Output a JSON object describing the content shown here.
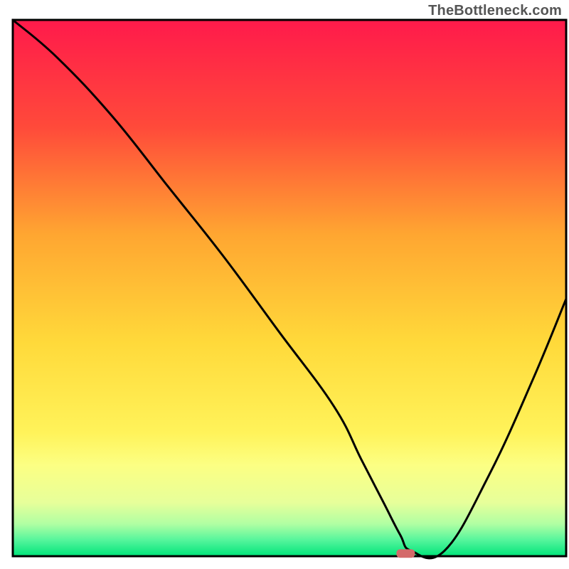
{
  "watermark": "TheBottleneck.com",
  "chart_data": {
    "type": "line",
    "title": "",
    "xlabel": "",
    "ylabel": "",
    "xlim": [
      0,
      100
    ],
    "ylim": [
      0,
      100
    ],
    "background_gradient": {
      "stops": [
        {
          "offset": 0,
          "color": "#ff1a4b"
        },
        {
          "offset": 20,
          "color": "#ff4a3a"
        },
        {
          "offset": 40,
          "color": "#ffa631"
        },
        {
          "offset": 60,
          "color": "#ffd93a"
        },
        {
          "offset": 77,
          "color": "#fff35a"
        },
        {
          "offset": 83,
          "color": "#fcff83"
        },
        {
          "offset": 90,
          "color": "#e7ff9a"
        },
        {
          "offset": 94,
          "color": "#b0ffa3"
        },
        {
          "offset": 97,
          "color": "#55f59c"
        },
        {
          "offset": 100,
          "color": "#00e47a"
        }
      ]
    },
    "series": [
      {
        "name": "bottleneck-curve",
        "color": "#000000",
        "x": [
          0,
          8,
          18,
          28,
          38,
          48,
          58,
          63,
          67,
          70,
          72,
          78,
          86,
          94,
          100
        ],
        "values": [
          100,
          93,
          82,
          69,
          56,
          42,
          28,
          18,
          10,
          4,
          1,
          1,
          15,
          33,
          48
        ]
      }
    ],
    "markers": [
      {
        "name": "optimal-point",
        "shape": "rounded-rect",
        "x": 71,
        "y": 0.5,
        "color": "#d46a6a"
      }
    ],
    "axes": {
      "frame_color": "#000000",
      "frame_width": 3,
      "show_ticks": false,
      "show_grid": false
    }
  }
}
